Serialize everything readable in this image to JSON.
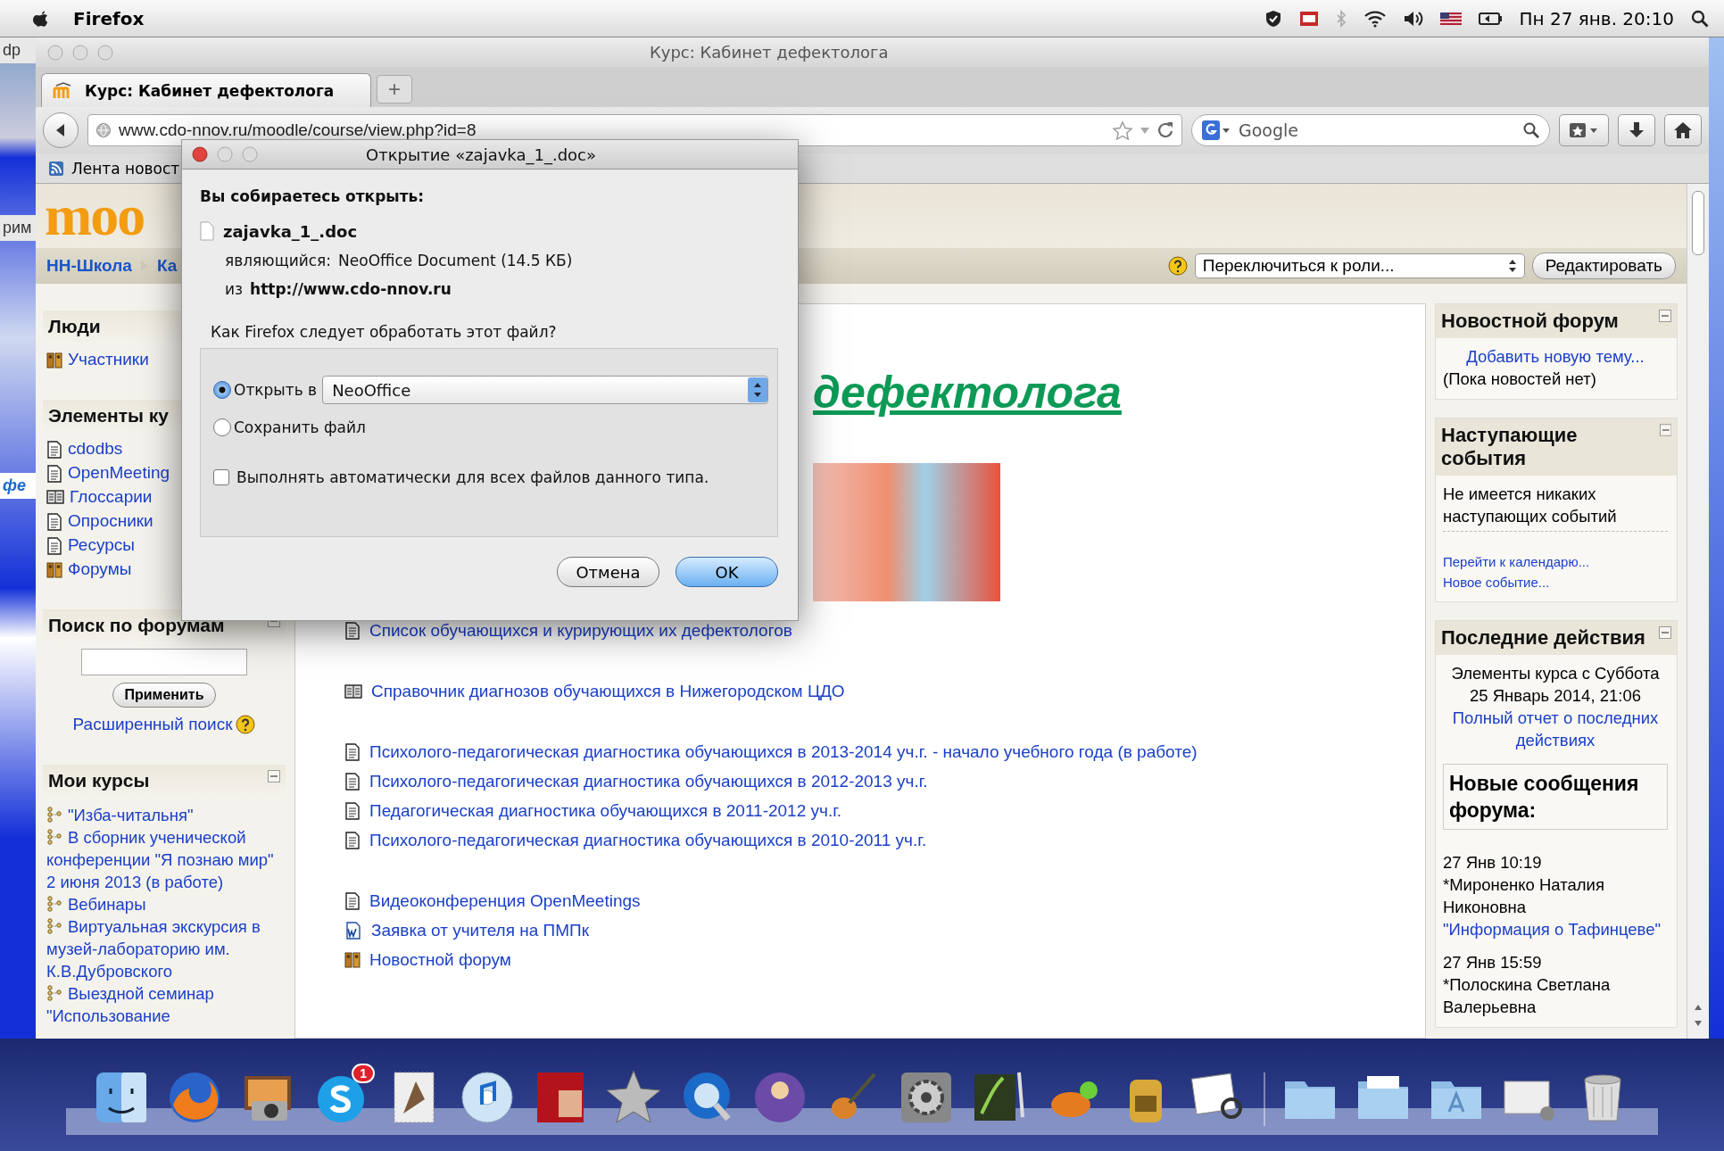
{
  "menubar": {
    "app": "Firefox",
    "clock": "Пн 27 янв. 20:10"
  },
  "desktop_fragments": [
    "dp",
    "рим",
    "фе"
  ],
  "window": {
    "title": "Курс: Кабинет дефектолога"
  },
  "tabs": [
    {
      "label": "Курс: Кабинет дефектолога",
      "selected": true
    }
  ],
  "new_tab": "+",
  "address": {
    "value": "www.cdo-nnov.ru/moodle/course/view.php?id=8"
  },
  "search": {
    "placeholder": "Google"
  },
  "bookmarks": [
    "Лента новост"
  ],
  "logo": "moo",
  "breadcrumb": [
    "НН-Школа",
    "Ка"
  ],
  "role_select": "Переключиться к роли...",
  "edit_button": "Редактировать",
  "left_blocks": [
    {
      "title": "Люди",
      "kind": "list",
      "collapsible": false,
      "items": [
        {
          "label": "Участники",
          "kind": "forum"
        }
      ]
    },
    {
      "title": "Элементы ку",
      "kind": "list",
      "collapsible": false,
      "items": [
        {
          "label": "cdodbs",
          "kind": "resource"
        },
        {
          "label": "OpenMeeting",
          "kind": "resource"
        },
        {
          "label": "Глоссарии",
          "kind": "glossary"
        },
        {
          "label": "Опросники",
          "kind": "resource"
        },
        {
          "label": "Ресурсы",
          "kind": "resource"
        },
        {
          "label": "Форумы",
          "kind": "forum"
        }
      ]
    },
    {
      "title": "Поиск по форумам",
      "kind": "search",
      "collapsible": true,
      "button": "Применить",
      "link": "Расширенный поиск"
    },
    {
      "title": "Мои курсы",
      "kind": "list",
      "collapsible": true,
      "items": [
        {
          "label": "\"Изба-читальня\"",
          "kind": "course"
        },
        {
          "label": "В сборник ученической конференции \"Я познаю мир\" 2 июня 2013 (в работе)",
          "kind": "course"
        },
        {
          "label": "Вебинары",
          "kind": "course"
        },
        {
          "label": "Виртуальная экскурсия в музей-лабораторию им. К.В.Дубровского",
          "kind": "course"
        },
        {
          "label": "Выездной семинар \"Использование",
          "kind": "course"
        }
      ]
    }
  ],
  "heading": "дефектолога",
  "link_groups": [
    [
      {
        "label": "Список обучающихся и курирующих их дефектологов",
        "kind": "resource"
      }
    ],
    [
      {
        "label": "Справочник диагнозов обучающихся в Нижегородском ЦДО",
        "kind": "glossary"
      }
    ],
    [
      {
        "label": "Психолого-педагогическая диагностика обучающихся в 2013-2014 уч.г. - начало учебного года (в работе)",
        "kind": "resource"
      },
      {
        "label": "Психолого-педагогическая диагностика обучающихся в 2012-2013 уч.г.",
        "kind": "resource"
      },
      {
        "label": "Педагогическая диагностика обучающихся в 2011-2012 уч.г.",
        "kind": "resource"
      },
      {
        "label": "Психолого-педагогическая диагностика обучающихся в 2010-2011 уч.г.",
        "kind": "resource"
      }
    ],
    [
      {
        "label": "Видеоконференция OpenMeetings",
        "kind": "resource"
      },
      {
        "label": "Заявка от учителя на ПМПк",
        "kind": "word"
      },
      {
        "label": "Новостной форум",
        "kind": "forum"
      }
    ]
  ],
  "right_blocks": [
    {
      "title": "Новостной форум",
      "lines": [
        {
          "text": "Добавить новую тему...",
          "kind": "center_link"
        },
        {
          "text": "(Пока новостей нет)",
          "kind": "text"
        }
      ]
    },
    {
      "title": "Наступающие события",
      "lines": [
        {
          "text": "Не имеется никаких наступающих событий",
          "kind": "text_ruled"
        },
        {
          "text": "Перейти к календарю...",
          "kind": "small_link"
        },
        {
          "text": "Новое событие...",
          "kind": "small_link"
        }
      ]
    },
    {
      "title": "Последние действия",
      "lines": [
        {
          "text": "Элементы курса с Суббота 25 Январь 2014, 21:06",
          "kind": "center_text"
        },
        {
          "text": "Полный отчет о последних действиях",
          "kind": "center_link"
        },
        {
          "text": "Новые сообщения форума:",
          "kind": "boxed_title"
        },
        {
          "text": "27 Янв 10:19",
          "kind": "text_gap"
        },
        {
          "text": "*Мироненко Наталия Никоновна",
          "kind": "text"
        },
        {
          "text": "\"Информация о Тафинцеве\"",
          "kind": "link"
        },
        {
          "text": "27 Янв 15:59",
          "kind": "text_gap"
        },
        {
          "text": "*Полоскина Светлана Валерьевна",
          "kind": "text"
        }
      ]
    }
  ],
  "dialog": {
    "title": "Открытие «zajavka_1_.doc»",
    "intro": "Вы собираетесь открыть:",
    "file": "zajavka_1_.doc",
    "type_label": "являющийся:",
    "type_value": "NeoOffice Document (14.5 КБ)",
    "from_label": "из",
    "from_value": "http://www.cdo-nnov.ru",
    "question": "Как Firefox следует обработать этот файл?",
    "options": [
      {
        "label": "Открыть в",
        "selected": true
      },
      {
        "label": "Сохранить файл",
        "selected": false
      }
    ],
    "app_select": "NeoOffice",
    "auto": {
      "label": "Выполнять автоматически для всех файлов данного типа.",
      "checked": false
    },
    "buttons": [
      {
        "label": "Отмена",
        "kind": "cancel"
      },
      {
        "label": "OK",
        "kind": "default"
      }
    ]
  },
  "dock": {
    "badge": "1"
  }
}
